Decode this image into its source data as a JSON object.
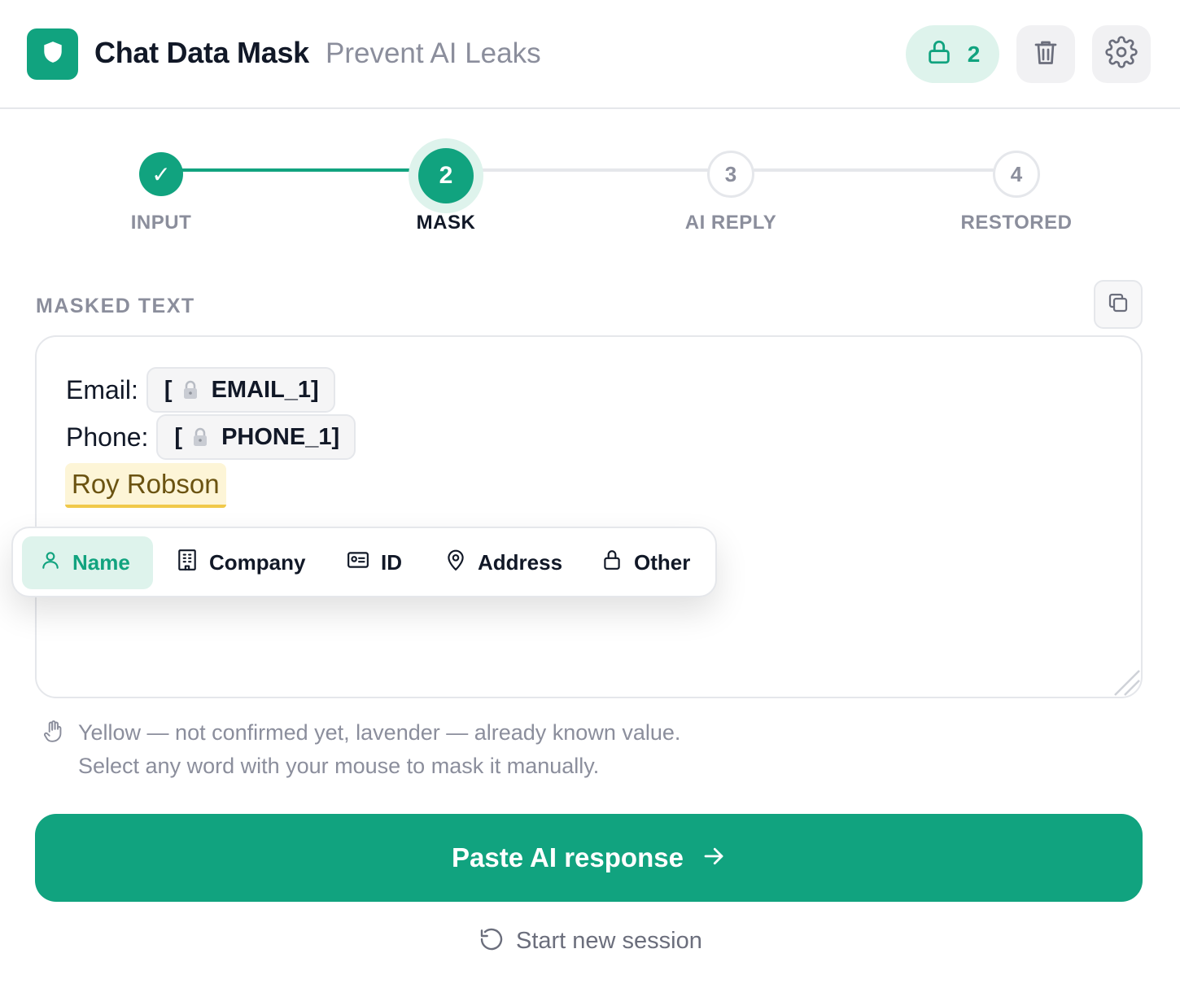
{
  "header": {
    "title": "Chat Data Mask",
    "subtitle": "Prevent AI Leaks",
    "masked_count": "2",
    "icons": {
      "logo": "shield-icon",
      "lock": "lock-icon",
      "trash": "trash-icon",
      "settings": "gear-icon"
    }
  },
  "stepper": {
    "steps": [
      {
        "number": "✓",
        "label": "INPUT",
        "state": "done"
      },
      {
        "number": "2",
        "label": "MASK",
        "state": "active"
      },
      {
        "number": "3",
        "label": "AI REPLY",
        "state": "pending"
      },
      {
        "number": "4",
        "label": "RESTORED",
        "state": "pending"
      }
    ]
  },
  "masked_section": {
    "label": "MASKED TEXT",
    "lines": [
      {
        "prefix": "Email:",
        "token": "EMAIL_1]",
        "bracket": "["
      },
      {
        "prefix": "Phone:",
        "token": "PHONE_1]",
        "bracket": "["
      }
    ],
    "unconfirmed_highlight": "Roy Robson"
  },
  "category_popup": {
    "items": [
      {
        "label": "Name",
        "icon": "user-icon",
        "selected": true
      },
      {
        "label": "Company",
        "icon": "building-icon",
        "selected": false
      },
      {
        "label": "ID",
        "icon": "id-card-icon",
        "selected": false
      },
      {
        "label": "Address",
        "icon": "map-pin-icon",
        "selected": false
      },
      {
        "label": "Other",
        "icon": "lock-icon",
        "selected": false
      }
    ]
  },
  "hint": {
    "line1": "Yellow — not confirmed yet, lavender — already known value.",
    "line2": "Select any word with your mouse to mask it manually."
  },
  "actions": {
    "primary_label": "Paste AI response",
    "secondary_label": "Start new session"
  },
  "colors": {
    "accent": "#11a37f",
    "accent_soft": "#def3ec",
    "muted_text": "#8b8e9c",
    "highlight_yellow": "#fdf5d7",
    "highlight_border": "#f0c94a"
  }
}
